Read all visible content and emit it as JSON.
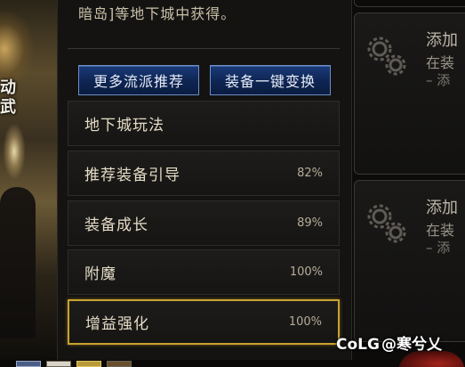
{
  "scene": {
    "side_text": [
      "动",
      "武"
    ]
  },
  "panel": {
    "intro_text": "暗岛]等地下城中获得。",
    "buttons": {
      "more_builds": "更多流派推荐",
      "one_click_swap": "装备一键变换"
    },
    "rows": [
      {
        "label": "地下城玩法",
        "percent": ""
      },
      {
        "label": "推荐装备引导",
        "percent": "82%"
      },
      {
        "label": "装备成长",
        "percent": "89%"
      },
      {
        "label": "附魔",
        "percent": "100%"
      },
      {
        "label": "增益强化",
        "percent": "100%",
        "selected": true
      }
    ]
  },
  "cards": [
    {
      "title": "添加",
      "line1": "在装",
      "line2": "– 添",
      "icon": "gears-icon"
    },
    {
      "title": "添加",
      "line1": "在装",
      "line2": "– 添",
      "icon": "gears-icon"
    }
  ],
  "watermark": {
    "brand": "CoLG",
    "text": "@寒兮乂"
  },
  "colors": {
    "accent_blue": "#1a3a78",
    "selected_gold": "#c9a230"
  }
}
